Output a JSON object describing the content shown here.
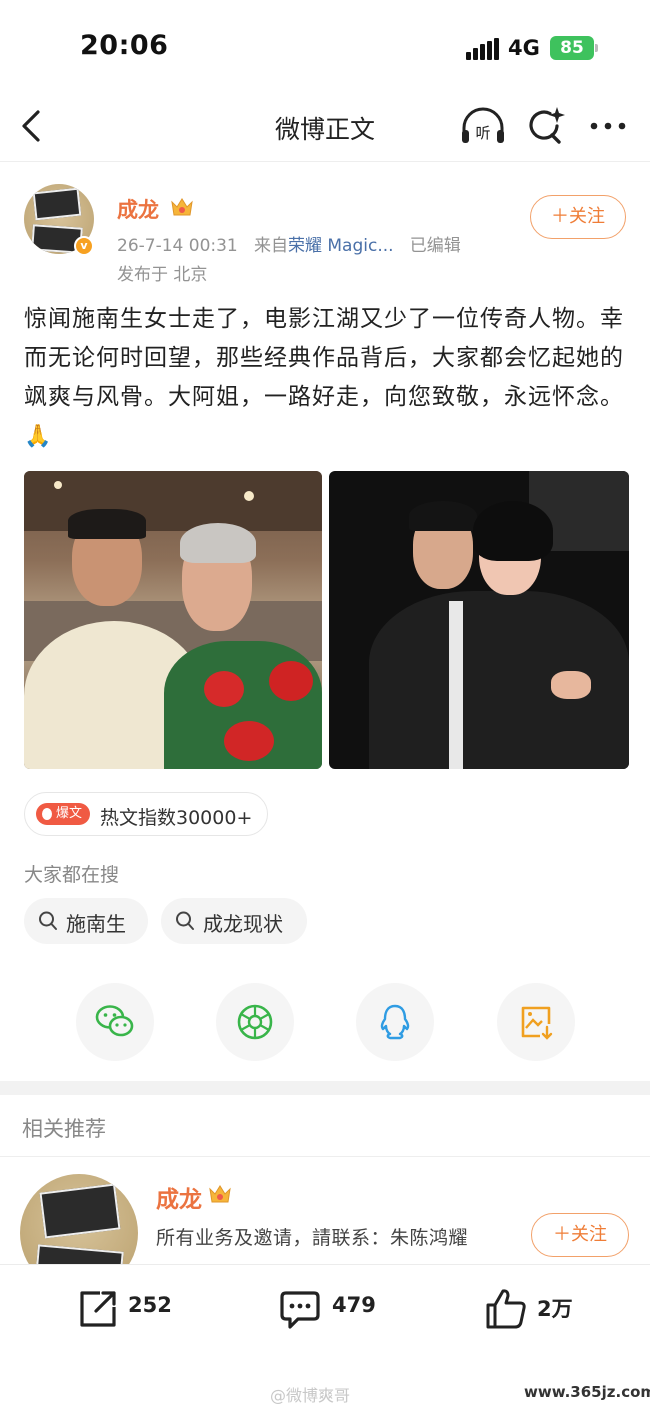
{
  "status_bar": {
    "time": "20:06",
    "network": "4G",
    "battery": "85"
  },
  "nav": {
    "title": "微博正文",
    "listen_label": "听"
  },
  "post": {
    "author": "成龙",
    "date": "26-7-14 00:31",
    "source_prefix": "来自",
    "source": "荣耀 Magic...",
    "edited": "已编辑",
    "location": "发布于 北京",
    "follow_label": "＋关注",
    "text": "惊闻施南生女士走了，电影江湖又少了一位传奇人物。幸而无论何时回望，那些经典作品背后，大家都会忆起她的飒爽与风骨。大阿姐，一路好走，向您致敬，永远怀念。",
    "emoji": "🙏",
    "hot_tag": "爆文",
    "hot_text": "热文指数30000+"
  },
  "search": {
    "label": "大家都在搜",
    "chips": [
      "施南生",
      "成龙现状"
    ]
  },
  "share_icons": [
    "wechat-icon",
    "moments-icon",
    "qq-icon",
    "save-image-icon"
  ],
  "related": {
    "title": "相关推荐",
    "name": "成龙",
    "desc": "所有业务及邀请，請联系：朱陈鸿耀",
    "follow_label": "＋关注"
  },
  "toolbar": {
    "reposts": "252",
    "comments": "479",
    "likes": "2万"
  },
  "watermark": {
    "text": "@微博爽哥",
    "site": "www.365jz.com"
  },
  "colors": {
    "accent": "#eb7340",
    "link": "#4a70a8",
    "battery": "#3ec25d"
  }
}
